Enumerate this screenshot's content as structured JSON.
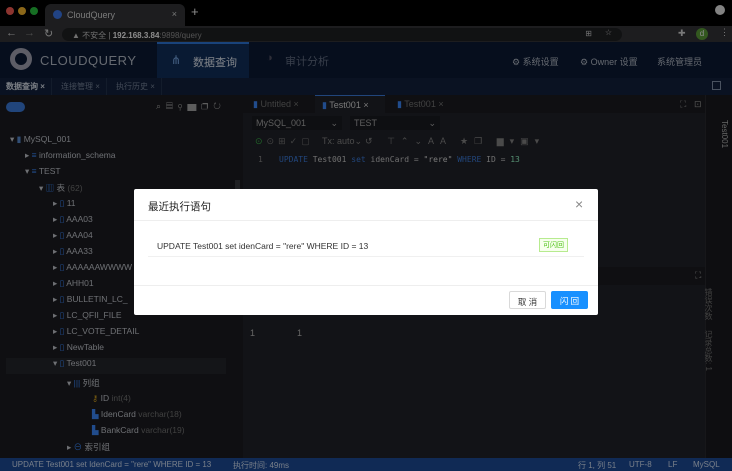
{
  "browser": {
    "tab_title": "CloudQuery",
    "insecure_label": "不安全",
    "url_host": "192.168.3.84",
    "url_rest": ":9898/query",
    "profile_initial": "d"
  },
  "app": {
    "logo": "CLOUDQUERY",
    "nav": [
      "数据查询",
      "审计分析"
    ],
    "right_menu": [
      "系统设置",
      "Owner 设置",
      "系统管理员"
    ]
  },
  "subtabs": [
    "数据查询",
    "连接管理",
    "执行历史"
  ],
  "tree": {
    "connection": "MySQL_001",
    "schemas": [
      "information_schema",
      "TEST"
    ],
    "tables_label": "表",
    "tables_count": "(62)",
    "tables": [
      "11",
      "AAA03",
      "AAA04",
      "AAA33",
      "AAAAAAWWWW",
      "AHH01",
      "BULLETIN_LC_",
      "LC_QFII_FILE",
      "LC_VOTE_DETAIL",
      "NewTable",
      "Test001"
    ],
    "columns_group": "列组",
    "columns": [
      {
        "name": "ID",
        "type": "int(4)"
      },
      {
        "name": "IdenCard",
        "type": "varchar(18)"
      },
      {
        "name": "BankCard",
        "type": "varchar(19)"
      }
    ],
    "index_group": "索引组"
  },
  "editor": {
    "tabs": [
      "Untitled",
      "Test001",
      "Test001"
    ],
    "connection_select": "MySQL_001",
    "database_select": "TEST",
    "tx_mode": "Tx: auto",
    "line_number": "1",
    "code": {
      "k1": "UPDATE",
      "t1": " Test001 ",
      "k2": "set",
      "t2": " idenCard = ",
      "s": "\"rere\"",
      "k3": " WHERE",
      "t3": " ID = ",
      "n": "13"
    },
    "result_row_num": "1",
    "result_value": "1"
  },
  "right_strip": {
    "tab": "Test001",
    "err_label": "错误次数",
    "total_label": "记录总数: 1"
  },
  "status": {
    "sql": "UPDATE Test001 set IdenCard = \"rere\" WHERE ID = 13",
    "exec_time": "执行时间: 49ms",
    "position": "行 1, 列 51",
    "encoding": "UTF-8",
    "eol": "LF",
    "lang": "MySQL"
  },
  "modal": {
    "title": "最近执行语句",
    "statement": "UPDATE Test001 set idenCard = \"rere\" WHERE ID = 13",
    "tag": "可闪回",
    "cancel": "取 消",
    "confirm": "闪 回"
  }
}
